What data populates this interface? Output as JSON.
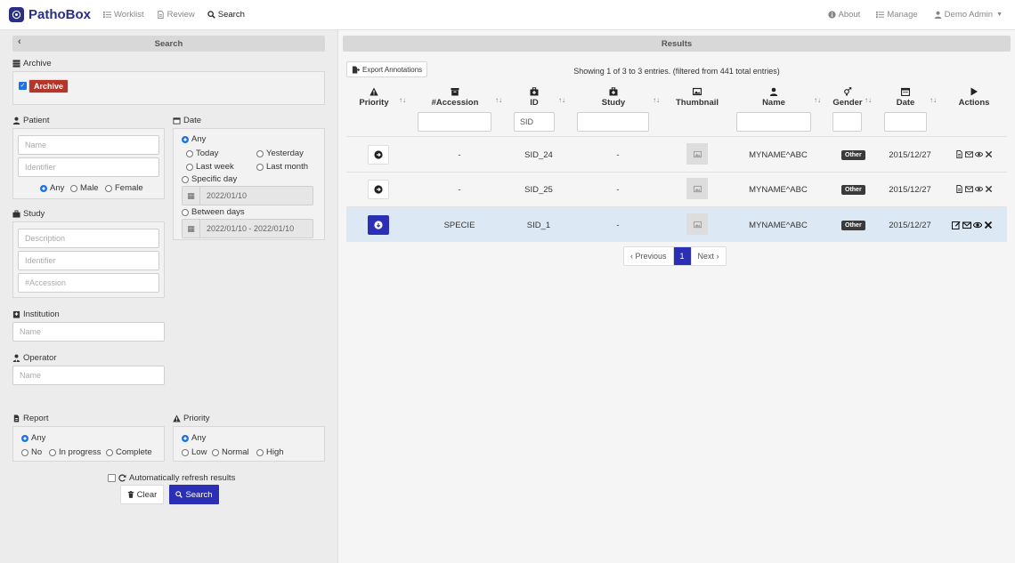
{
  "nav": {
    "brand": "PathoBox",
    "links": [
      {
        "label": "Worklist",
        "icon": "list-icon"
      },
      {
        "label": "Review",
        "icon": "file-icon"
      },
      {
        "label": "Search",
        "icon": "search-icon",
        "active": true
      }
    ],
    "right": [
      {
        "label": "About",
        "icon": "info-icon"
      },
      {
        "label": "Manage",
        "icon": "list-icon"
      },
      {
        "label": "Demo Admin",
        "icon": "user-icon"
      }
    ]
  },
  "search_panel": {
    "title": "Search",
    "archive": {
      "label": "Archive",
      "tag": "Archive",
      "checked": true
    },
    "patient": {
      "label": "Patient",
      "name_placeholder": "Name",
      "identifier_placeholder": "Identifier",
      "gender_options": [
        "Any",
        "Male",
        "Female"
      ],
      "gender_selected": "Any"
    },
    "date": {
      "label": "Date",
      "options": [
        "Any",
        "Today",
        "Yesterday",
        "Last week",
        "Last month",
        "Specific day",
        "Between days"
      ],
      "selected": "Any",
      "specific_day_value": "2022/01/10",
      "between_days_value": "2022/01/10 - 2022/01/10"
    },
    "study": {
      "label": "Study",
      "description_placeholder": "Description",
      "identifier_placeholder": "Identifier",
      "accession_placeholder": "#Accession"
    },
    "institution": {
      "label": "Institution",
      "placeholder": "Name"
    },
    "operator": {
      "label": "Operator",
      "placeholder": "Name"
    },
    "report": {
      "label": "Report",
      "options": [
        "Any",
        "No",
        "In progress",
        "Complete"
      ],
      "selected": "Any"
    },
    "priority": {
      "label": "Priority",
      "options": [
        "Any",
        "Low",
        "Normal",
        "High"
      ],
      "selected": "Any"
    },
    "auto_refresh": {
      "label": "Automatically refresh results",
      "checked": false
    },
    "clear_label": "Clear",
    "search_label": "Search"
  },
  "results": {
    "title": "Results",
    "export_label": "Export Annotations",
    "showing": "Showing 1 of 3 to 3 entries. (filtered from 441 total entries)",
    "columns": [
      "Priority",
      "#Accession",
      "ID",
      "Study",
      "Thumbnail",
      "Name",
      "Gender",
      "Date",
      "Actions"
    ],
    "id_filter_value": "SID",
    "rows": [
      {
        "accession": "-",
        "id": "SID_24",
        "study": "-",
        "name": "MYNAME^ABC",
        "gender": "Other",
        "date": "2015/12/27",
        "selected": false
      },
      {
        "accession": "-",
        "id": "SID_25",
        "study": "-",
        "name": "MYNAME^ABC",
        "gender": "Other",
        "date": "2015/12/27",
        "selected": false
      },
      {
        "accession": "SPECIE",
        "id": "SID_1",
        "study": "-",
        "name": "MYNAME^ABC",
        "gender": "Other",
        "date": "2015/12/27",
        "selected": true
      }
    ],
    "pagination": {
      "previous": "‹ Previous",
      "current": "1",
      "next": "Next ›"
    }
  },
  "colors": {
    "brand": "#2a2f86",
    "primary": "#2b2fb5",
    "archive_tag": "#b5352b",
    "selected_row": "#dce9f5"
  }
}
